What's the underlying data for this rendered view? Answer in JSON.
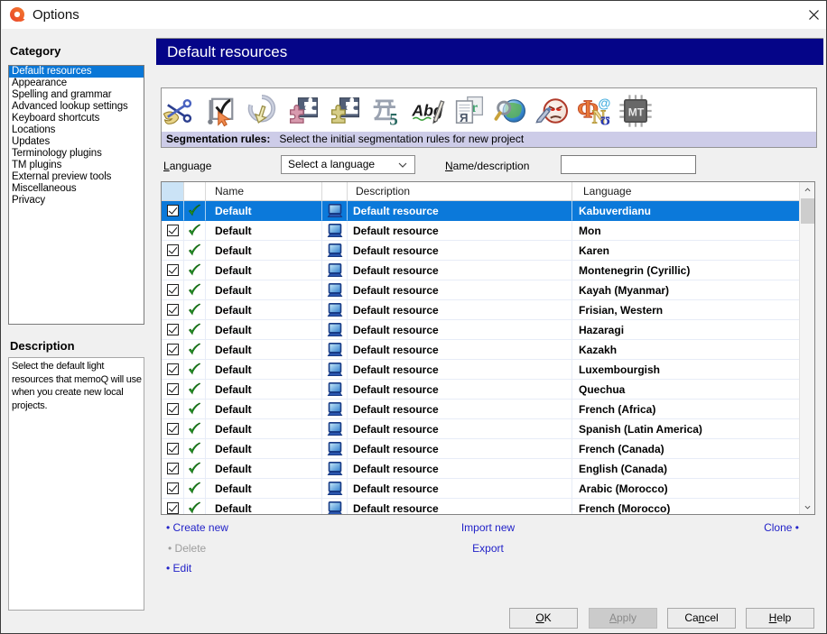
{
  "bullet": "•",
  "colors": {
    "band_bg": "#050588",
    "selection_blue": "#0b79da",
    "info_bar_bg": "#cdcce8",
    "link_blue": "#2222c8",
    "logo_orange": "#f05a28",
    "logo_red": "#e8432d"
  },
  "window": {
    "title": "Options"
  },
  "sidebar": {
    "category_label": "Category",
    "items": [
      {
        "label": "Default resources",
        "selected": true
      },
      {
        "label": "Appearance",
        "selected": false
      },
      {
        "label": "Spelling and grammar",
        "selected": false
      },
      {
        "label": "Advanced lookup settings",
        "selected": false
      },
      {
        "label": "Keyboard shortcuts",
        "selected": false
      },
      {
        "label": "Locations",
        "selected": false
      },
      {
        "label": "Updates",
        "selected": false
      },
      {
        "label": "Terminology plugins",
        "selected": false
      },
      {
        "label": "TM plugins",
        "selected": false
      },
      {
        "label": "External preview tools",
        "selected": false
      },
      {
        "label": "Miscellaneous",
        "selected": false
      },
      {
        "label": "Privacy",
        "selected": false
      }
    ],
    "description_label": "Description",
    "description_text": "Select the default light resources that memoQ will use when you create new local projects."
  },
  "main": {
    "page_title": "Default resources",
    "toolbar_icons": [
      "segmentation-rules",
      "qa-settings",
      "auto-translation-rules",
      "tm-settings",
      "livedocs-settings",
      "number-formats",
      "autocorrect-lists",
      "export-path-rules",
      "web-search-settings",
      "offensive-words",
      "font-substitution",
      "mt-settings"
    ],
    "info_bar": {
      "label": "Segmentation rules:",
      "text": "Select the initial segmentation rules for new project"
    },
    "filters": {
      "language_label": {
        "accel": "L",
        "post": "anguage"
      },
      "language_value": "Select a language",
      "name_label": {
        "accel": "N",
        "post": "ame/description"
      },
      "name_value": ""
    },
    "table": {
      "columns": {
        "name": "Name",
        "description": "Description",
        "language": "Language"
      },
      "rows": [
        {
          "checked": true,
          "name": "Default",
          "description": "Default resource",
          "language": "Kabuverdianu",
          "selected": true
        },
        {
          "checked": true,
          "name": "Default",
          "description": "Default resource",
          "language": "Mon",
          "selected": false
        },
        {
          "checked": true,
          "name": "Default",
          "description": "Default resource",
          "language": "Karen",
          "selected": false
        },
        {
          "checked": true,
          "name": "Default",
          "description": "Default resource",
          "language": "Montenegrin (Cyrillic)",
          "selected": false
        },
        {
          "checked": true,
          "name": "Default",
          "description": "Default resource",
          "language": "Kayah (Myanmar)",
          "selected": false
        },
        {
          "checked": true,
          "name": "Default",
          "description": "Default resource",
          "language": "Frisian, Western",
          "selected": false
        },
        {
          "checked": true,
          "name": "Default",
          "description": "Default resource",
          "language": "Hazaragi",
          "selected": false
        },
        {
          "checked": true,
          "name": "Default",
          "description": "Default resource",
          "language": "Kazakh",
          "selected": false
        },
        {
          "checked": true,
          "name": "Default",
          "description": "Default resource",
          "language": "Luxembourgish",
          "selected": false
        },
        {
          "checked": true,
          "name": "Default",
          "description": "Default resource",
          "language": "Quechua",
          "selected": false
        },
        {
          "checked": true,
          "name": "Default",
          "description": "Default resource",
          "language": "French (Africa)",
          "selected": false
        },
        {
          "checked": true,
          "name": "Default",
          "description": "Default resource",
          "language": "Spanish (Latin America)",
          "selected": false
        },
        {
          "checked": true,
          "name": "Default",
          "description": "Default resource",
          "language": "French (Canada)",
          "selected": false
        },
        {
          "checked": true,
          "name": "Default",
          "description": "Default resource",
          "language": "English (Canada)",
          "selected": false
        },
        {
          "checked": true,
          "name": "Default",
          "description": "Default resource",
          "language": "Arabic (Morocco)",
          "selected": false
        },
        {
          "checked": true,
          "name": "Default",
          "description": "Default resource",
          "language": "French (Morocco)",
          "selected": false
        }
      ]
    },
    "links": {
      "create_new": "Create new",
      "delete": "Delete",
      "edit": "Edit",
      "import_new": "Import new",
      "export": "Export",
      "clone": "Clone"
    },
    "buttons": {
      "ok": {
        "pre": "",
        "accel": "O",
        "post": "K"
      },
      "apply": {
        "pre": "",
        "accel": "A",
        "post": "pply"
      },
      "cancel": {
        "pre": "Ca",
        "accel": "n",
        "post": "cel"
      },
      "help": {
        "pre": "",
        "accel": "H",
        "post": "elp"
      }
    }
  }
}
